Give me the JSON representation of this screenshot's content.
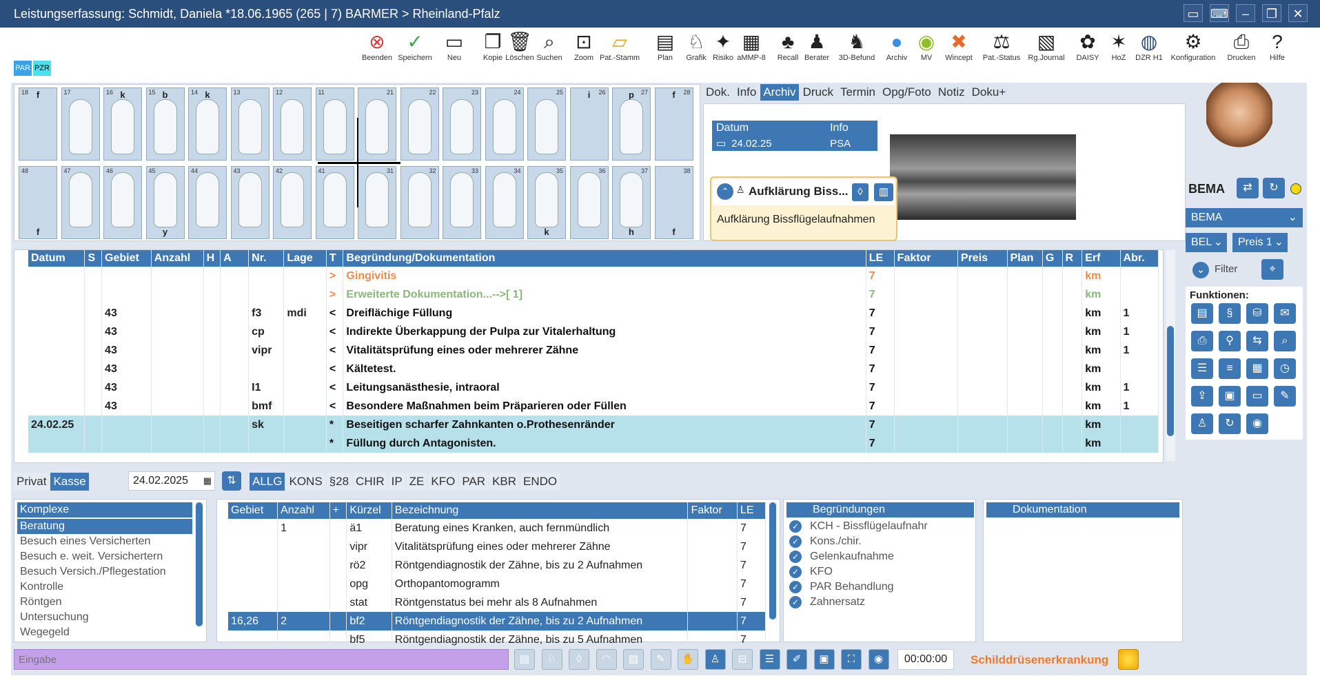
{
  "title": "Leistungserfassung: Schmidt, Daniela *18.06.1965 (265 |  7) BARMER > Rheinland-Pfalz",
  "toolbar": [
    "Beenden",
    "Speichern",
    "Neu",
    "Kopie",
    "Löschen",
    "Suchen",
    "Zoom",
    "Pat.-Stamm",
    "Plan",
    "Grafik",
    "Risiko",
    "aMMP-8",
    "Recall",
    "Berater",
    "3D-Befund",
    "Archiv",
    "MV",
    "Wincept",
    "Pat.-Status",
    "Rg.Journal",
    "DAISY",
    "HoZ",
    "DZR H1",
    "Konfiguration",
    "Drucken",
    "Hilfe"
  ],
  "toolbar_icons": [
    "close-icon",
    "save-icon",
    "folder-new-icon",
    "copy-icon",
    "trash-icon",
    "search-icon",
    "zoom-icon",
    "card-icon",
    "document-icon",
    "tooth-icon",
    "risk-icon",
    "barcode-icon",
    "recall-icon",
    "people-icon",
    "tooth-3d-icon",
    "globe-icon",
    "mv-icon",
    "wincept-icon",
    "status-icon",
    "journal-icon",
    "daisy-icon",
    "hoz-icon",
    "dzr-icon",
    "gear-icon",
    "printer-icon",
    "help-icon"
  ],
  "badges": [
    "PAR",
    "PZR"
  ],
  "teeth_upper": [
    {
      "n": "18",
      "top": "f",
      "bot": ""
    },
    {
      "n": "17",
      "top": "",
      "bot": ""
    },
    {
      "n": "16",
      "top": "k",
      "bot": ""
    },
    {
      "n": "15",
      "top": "b",
      "bot": ""
    },
    {
      "n": "14",
      "top": "k",
      "bot": ""
    },
    {
      "n": "13",
      "top": "",
      "bot": ""
    },
    {
      "n": "12",
      "top": "",
      "bot": ""
    },
    {
      "n": "11",
      "top": "",
      "bot": ""
    },
    {
      "n": "21",
      "top": "",
      "bot": ""
    },
    {
      "n": "22",
      "top": "",
      "bot": ""
    },
    {
      "n": "23",
      "top": "",
      "bot": ""
    },
    {
      "n": "24",
      "top": "",
      "bot": ""
    },
    {
      "n": "25",
      "top": "",
      "bot": ""
    },
    {
      "n": "26",
      "top": "i",
      "bot": ""
    },
    {
      "n": "27",
      "top": "p",
      "bot": ""
    },
    {
      "n": "28",
      "top": "f",
      "bot": ""
    }
  ],
  "teeth_lower": [
    {
      "n": "48",
      "top": "",
      "bot": "f"
    },
    {
      "n": "47",
      "top": "",
      "bot": ""
    },
    {
      "n": "46",
      "top": "",
      "bot": ""
    },
    {
      "n": "45",
      "top": "",
      "bot": "y"
    },
    {
      "n": "44",
      "top": "",
      "bot": ""
    },
    {
      "n": "43",
      "top": "",
      "bot": ""
    },
    {
      "n": "42",
      "top": "",
      "bot": ""
    },
    {
      "n": "41",
      "top": "",
      "bot": ""
    },
    {
      "n": "31",
      "top": "",
      "bot": ""
    },
    {
      "n": "32",
      "top": "",
      "bot": ""
    },
    {
      "n": "33",
      "top": "",
      "bot": ""
    },
    {
      "n": "34",
      "top": "",
      "bot": ""
    },
    {
      "n": "35",
      "top": "",
      "bot": "k"
    },
    {
      "n": "36",
      "top": "",
      "bot": ""
    },
    {
      "n": "37",
      "top": "",
      "bot": "h"
    },
    {
      "n": "38",
      "top": "",
      "bot": "f"
    }
  ],
  "doc_tabs": [
    "Dok.",
    "Info",
    "Archiv",
    "Druck",
    "Termin",
    "Opg/Foto",
    "Notiz",
    "Doku+"
  ],
  "archive": {
    "headers": [
      "Datum",
      "Info"
    ],
    "rows": [
      [
        "24.02.25",
        "PSA"
      ]
    ]
  },
  "popup": {
    "title": "Aufklärung Biss...",
    "text": "Aufklärung Bissflügelaufnahmen"
  },
  "side": {
    "bema_label": "BEMA",
    "select_bema": "BEMA",
    "select_bel": "BEL",
    "select_preis": "Preis 1",
    "filter": "Filter",
    "funktionen": "Funktionen:"
  },
  "main_table": {
    "headers": [
      "Datum",
      "S",
      "Gebiet",
      "Anzahl",
      "H",
      "A",
      "Nr.",
      "Lage",
      "T",
      "Begründung/Dokumentation",
      "LE",
      "Faktor",
      "Preis",
      "Plan",
      "G",
      "R",
      "Erf",
      "Abr."
    ],
    "rows": [
      {
        "datum": "",
        "gebiet": "",
        "nr": "",
        "lage": "",
        "t": ">",
        "text": "Gingivitis",
        "le": "7",
        "erf": "km",
        "abr": "",
        "style": "orange"
      },
      {
        "datum": "",
        "gebiet": "",
        "nr": "",
        "lage": "",
        "t": ">",
        "text": "Erweiterte Dokumentation...-->[  1]",
        "le": "7",
        "erf": "km",
        "abr": "",
        "style": "green"
      },
      {
        "datum": "",
        "gebiet": "43",
        "nr": "f3",
        "lage": "mdi",
        "t": "<",
        "text": "Dreiflächige Füllung",
        "le": "7",
        "erf": "km",
        "abr": "1",
        "style": ""
      },
      {
        "datum": "",
        "gebiet": "43",
        "nr": "cp",
        "lage": "",
        "t": "<",
        "text": "Indirekte Überkappung der Pulpa zur Vitalerhaltung",
        "le": "7",
        "erf": "km",
        "abr": "1",
        "style": ""
      },
      {
        "datum": "",
        "gebiet": "43",
        "nr": "vipr",
        "lage": "",
        "t": "<",
        "text": "Vitalitätsprüfung eines oder mehrerer Zähne",
        "le": "7",
        "erf": "km",
        "abr": "1",
        "style": ""
      },
      {
        "datum": "",
        "gebiet": "43",
        "nr": "",
        "lage": "",
        "t": "<",
        "text": "Kältetest.",
        "le": "7",
        "erf": "km",
        "abr": "",
        "style": ""
      },
      {
        "datum": "",
        "gebiet": "43",
        "nr": "I1",
        "lage": "",
        "t": "<",
        "text": "Leitungsanästhesie, intraoral",
        "le": "7",
        "erf": "km",
        "abr": "1",
        "style": ""
      },
      {
        "datum": "",
        "gebiet": "43",
        "nr": "bmf",
        "lage": "",
        "t": "<",
        "text": "Besondere Maßnahmen beim Präparieren oder Füllen",
        "le": "7",
        "erf": "km",
        "abr": "1",
        "style": ""
      },
      {
        "datum": "24.02.25",
        "gebiet": "",
        "nr": "sk",
        "lage": "",
        "t": "*",
        "text": "Beseitigen scharfer Zahnkanten o.Prothesenränder",
        "le": "7",
        "erf": "km",
        "abr": "",
        "style": "sel"
      },
      {
        "datum": "",
        "gebiet": "",
        "nr": "",
        "lage": "",
        "t": "*",
        "text": "Füllung durch Antagonisten.",
        "le": "7",
        "erf": "km",
        "abr": "",
        "style": "sel"
      }
    ]
  },
  "filter_row": {
    "privat": "Privat",
    "kasse": "Kasse",
    "date": "24.02.2025",
    "cats": [
      "ALLG",
      "KONS",
      "§28",
      "CHIR",
      "IP",
      "ZE",
      "KFO",
      "PAR",
      "KBR",
      "ENDO"
    ]
  },
  "komplexe": {
    "header": "Komplexe",
    "items": [
      "Beratung",
      "Besuch eines Versicherten",
      "Besuch e. weit. Versichertern",
      "Besuch Versich./Pflegestation",
      "Kontrolle",
      "Röntgen",
      "Untersuchung",
      "Wegegeld"
    ]
  },
  "services": {
    "headers": [
      "Gebiet",
      "Anzahl",
      "+",
      "Kürzel",
      "Bezeichnung",
      "Faktor",
      "LE"
    ],
    "rows": [
      [
        "",
        "1",
        "",
        "ä1",
        "Beratung eines Kranken, auch fernmündlich",
        "",
        "7"
      ],
      [
        "",
        "",
        "",
        "vipr",
        "Vitalitätsprüfung eines oder mehrerer Zähne",
        "",
        "7"
      ],
      [
        "",
        "",
        "",
        "rö2",
        "Röntgendiagnostik der Zähne, bis zu 2 Aufnahmen",
        "",
        "7"
      ],
      [
        "",
        "",
        "",
        "opg",
        "Orthopantomogramm",
        "",
        "7"
      ],
      [
        "",
        "",
        "",
        "stat",
        "Röntgenstatus bei mehr als 8 Aufnahmen",
        "",
        "7"
      ],
      [
        "16,26",
        "2",
        "",
        "bf2",
        "Röntgendiagnostik der Zähne, bis zu 2 Aufnahmen",
        "",
        "7"
      ],
      [
        "",
        "",
        "",
        "bf5",
        "Röntgendiagnostik der Zähne, bis zu 5 Aufnahmen",
        "",
        "7"
      ]
    ]
  },
  "begruendungen": {
    "header": "Begründungen",
    "items": [
      "KCH - Bissflügelaufnahr",
      "Kons./chir.",
      "Gelenkaufnahme",
      "KFO",
      "PAR Behandlung",
      "Zahnersatz"
    ]
  },
  "dokumentation": {
    "header": "Dokumentation"
  },
  "footer": {
    "placeholder": "Eingabe",
    "timer": "00:00:00",
    "alert": "Schilddrüsenerkrankung"
  }
}
